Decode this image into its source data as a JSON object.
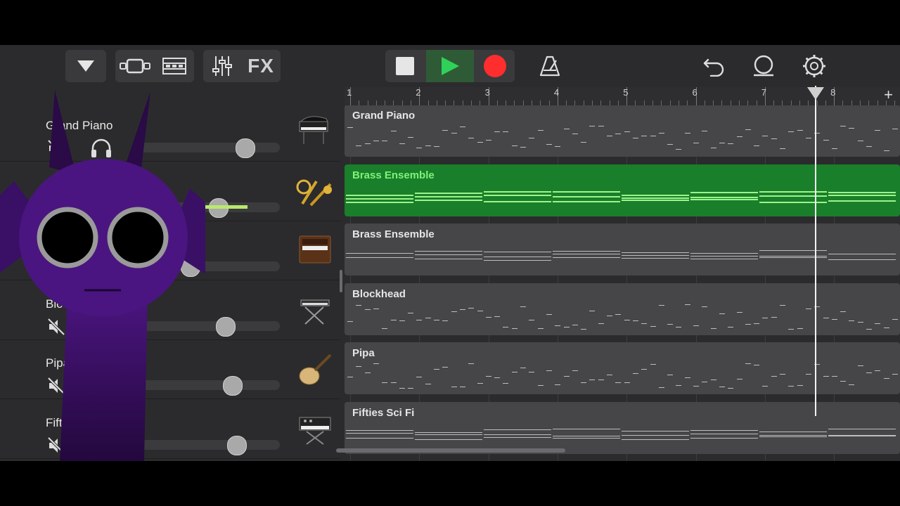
{
  "toolbar": {
    "fx_label": "FX",
    "buttons": [
      "browser-dropdown",
      "tracks-view",
      "loops-view",
      "mixer",
      "fx",
      "stop",
      "play",
      "record",
      "metronome",
      "undo",
      "loop",
      "settings"
    ]
  },
  "ruler": {
    "bars": [
      "1",
      "2",
      "3",
      "4",
      "5",
      "6",
      "7",
      "8"
    ],
    "add_label": "+"
  },
  "tracks": [
    {
      "header_name": "Grand Piano",
      "region_name": "Grand Piano",
      "volume": 0.75,
      "instrument_icon": "grand-piano-icon",
      "active": false
    },
    {
      "header_name": "",
      "region_name": "Brass Ensemble",
      "volume": 0.56,
      "instrument_icon": "brass-icon",
      "active": true
    },
    {
      "header_name": "",
      "region_name": "Brass Ensemble",
      "volume": 0.36,
      "instrument_icon": "organ-icon",
      "active": false
    },
    {
      "header_name": "Blo",
      "region_name": "Blockhead",
      "volume": 0.61,
      "instrument_icon": "keyboard-stand-icon",
      "active": false
    },
    {
      "header_name": "Pipa",
      "region_name": "Pipa",
      "volume": 0.66,
      "instrument_icon": "pipa-icon",
      "active": false
    },
    {
      "header_name": "Fift",
      "region_name": "Fifties Sci Fi",
      "volume": 0.69,
      "instrument_icon": "synth-icon",
      "active": false
    }
  ],
  "colors": {
    "accent_green": "#1a7f2a",
    "record_red": "#ff2d2d",
    "play_green": "#30d158",
    "character_purple": "#4b1580"
  }
}
